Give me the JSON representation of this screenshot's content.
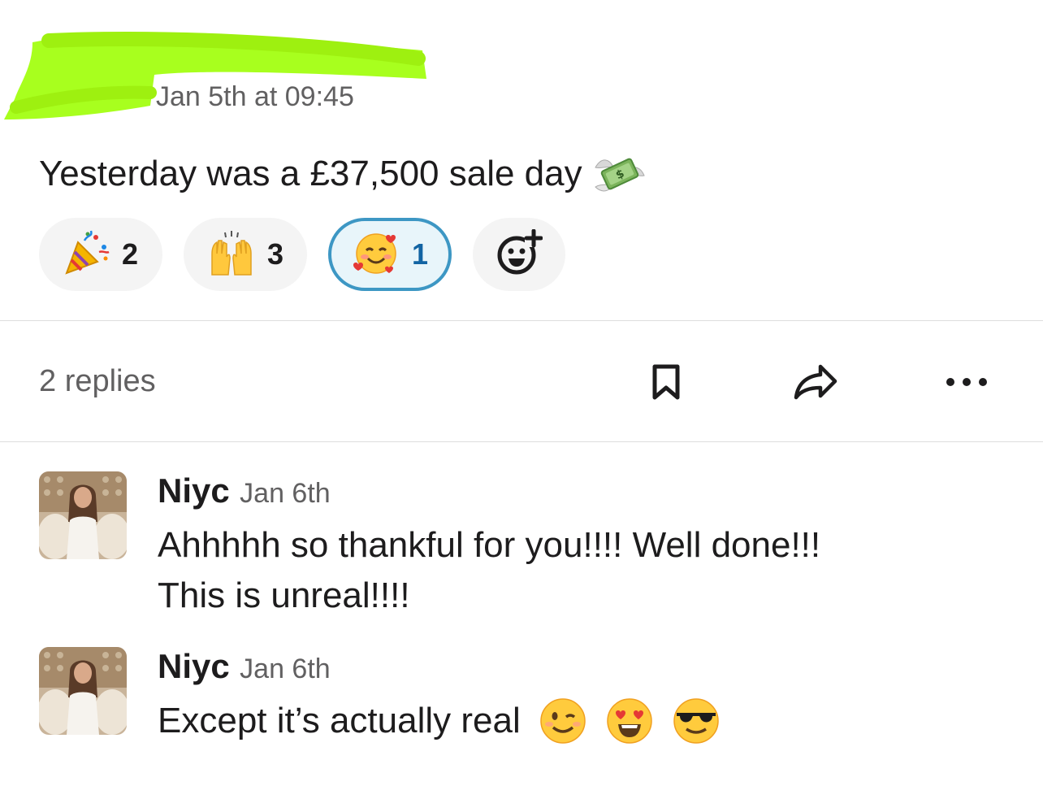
{
  "post": {
    "timestamp": "Jan 5th at 09:45",
    "text": "Yesterday was a £37,500 sale day",
    "text_emoji": "money-with-wings-icon"
  },
  "reactions": [
    {
      "emoji": "party-popper-icon",
      "count": "2",
      "selected": false
    },
    {
      "emoji": "raising-hands-icon",
      "count": "3",
      "selected": false
    },
    {
      "emoji": "smiling-face-with-hearts-icon",
      "count": "1",
      "selected": true
    }
  ],
  "add_reaction": {
    "icon": "add-reaction-icon"
  },
  "thread": {
    "replies_label": "2 replies",
    "actions": [
      "bookmark-icon",
      "share-icon",
      "more-icon"
    ]
  },
  "replies": [
    {
      "name": "Niyc",
      "date": "Jan 6th",
      "lines": [
        "Ahhhhh so thankful for you!!!! Well done!!!",
        "This is unreal!!!!"
      ]
    },
    {
      "name": "Niyc",
      "date": "Jan 6th",
      "lines": [
        "Except it’s actually real"
      ],
      "emojis": [
        "winking-face-icon",
        "heart-eyes-icon",
        "sunglasses-face-icon"
      ]
    }
  ],
  "colors": {
    "accent": "#3d97c4",
    "selected_bg": "#e8f5fa",
    "muted_text": "#616061",
    "redaction": "#a8ff1e"
  }
}
